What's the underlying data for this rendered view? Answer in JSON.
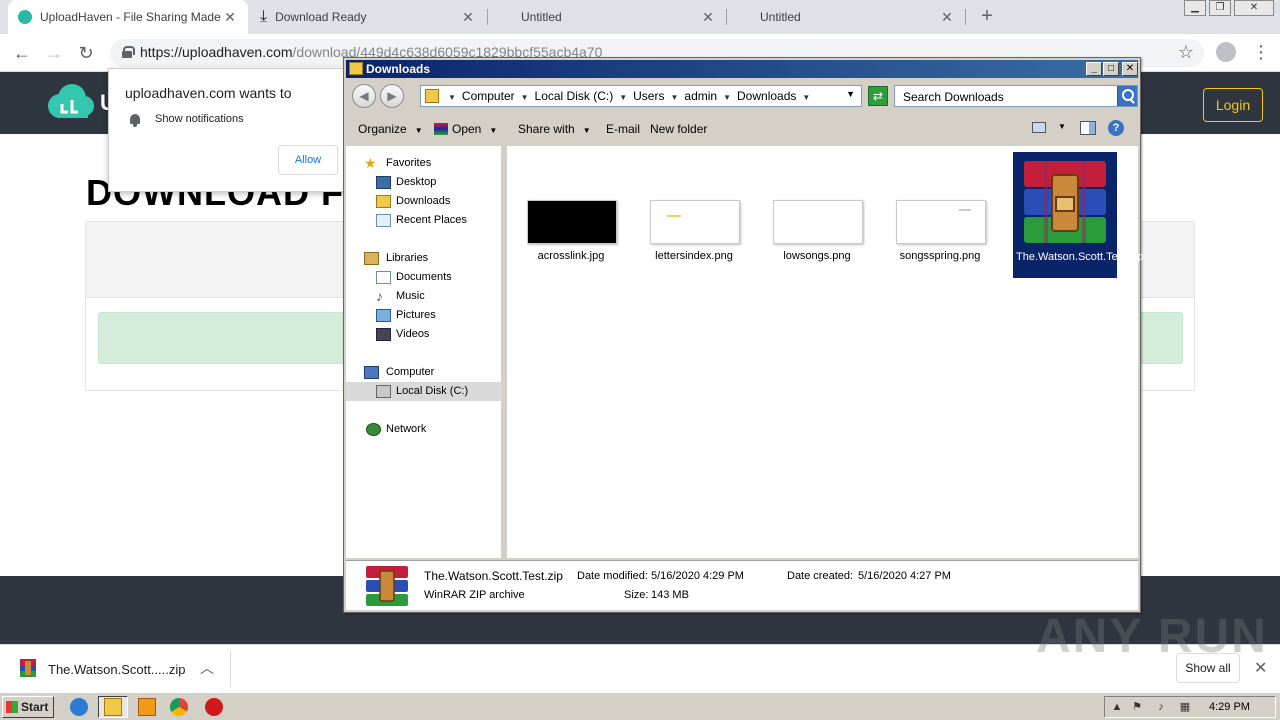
{
  "browser": {
    "tabs": [
      {
        "title": "UploadHaven - File Sharing Made Sim",
        "active": true
      },
      {
        "title": "Download Ready",
        "active": false
      },
      {
        "title": "Untitled",
        "active": false
      },
      {
        "title": "Untitled",
        "active": false
      }
    ],
    "url_host": "https://uploadhaven.com",
    "url_path": "/download/449d4c638d6059c1829bbcf55acb4a70"
  },
  "notification": {
    "heading": "uploadhaven.com wants to",
    "permission": "Show notifications",
    "allow_label": "Allow"
  },
  "site": {
    "login_label": "Login",
    "page_title": "DOWNLOAD F",
    "logo_letter": "U",
    "colors": {
      "header": "#2f3640",
      "accent": "#f5c518",
      "alert": "#d4eddb"
    }
  },
  "explorer": {
    "title": "Downloads",
    "breadcrumbs": [
      "Computer",
      "Local Disk (C:)",
      "Users",
      "admin",
      "Downloads"
    ],
    "search_placeholder": "Search Downloads",
    "commands": {
      "organize": "Organize",
      "open": "Open",
      "share_with": "Share with",
      "email": "E-mail",
      "new_folder": "New folder"
    },
    "nav": {
      "favorites": "Favorites",
      "desktop": "Desktop",
      "downloads": "Downloads",
      "recent_places": "Recent Places",
      "libraries": "Libraries",
      "documents": "Documents",
      "music": "Music",
      "pictures": "Pictures",
      "videos": "Videos",
      "computer": "Computer",
      "local_disk": "Local Disk (C:)",
      "network": "Network"
    },
    "files": [
      {
        "name": "acrosslink.jpg",
        "thumb": "black"
      },
      {
        "name": "lettersindex.png",
        "thumb": "white"
      },
      {
        "name": "lowsongs.png",
        "thumb": "white"
      },
      {
        "name": "songsspring.png",
        "thumb": "white"
      },
      {
        "name": "The.Watson.Scott.Test.zip",
        "thumb": "winrar",
        "selected": true
      }
    ],
    "details": {
      "name": "The.Watson.Scott.Test.zip",
      "type": "WinRAR ZIP archive",
      "date_modified_label": "Date modified:",
      "date_modified": "5/16/2020 4:29 PM",
      "date_created_label": "Date created:",
      "date_created": "5/16/2020 4:27 PM",
      "size_label": "Size:",
      "size": "143 MB"
    }
  },
  "shelf": {
    "download_name": "The.Watson.Scott.....zip",
    "show_all": "Show all",
    "watermark": "ANY RUN"
  },
  "taskbar": {
    "start_label": "Start",
    "clock": "4:29 PM"
  }
}
